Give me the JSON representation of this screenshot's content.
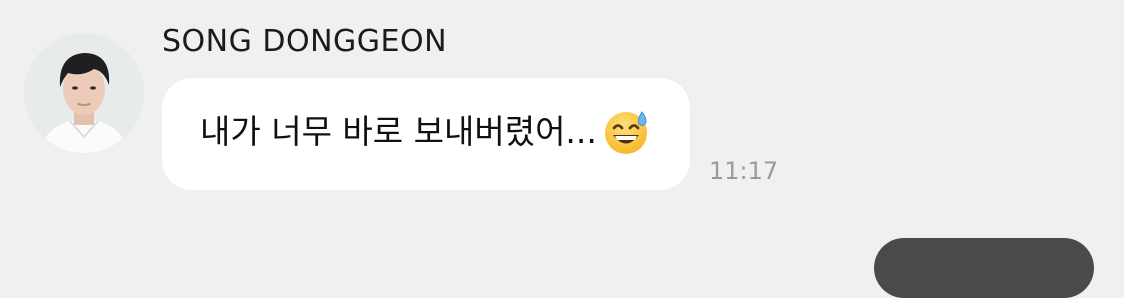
{
  "message": {
    "sender_name": "SONG DONGGEON",
    "text": "내가 너무 바로 보내버렸어...",
    "emoji": "grinning-face-with-sweat",
    "time": "11:17"
  },
  "colors": {
    "background": "#f0f0f0",
    "bubble": "#ffffff",
    "timestamp": "#9a9a9a",
    "outgoing_bubble": "#4a4a4a"
  }
}
